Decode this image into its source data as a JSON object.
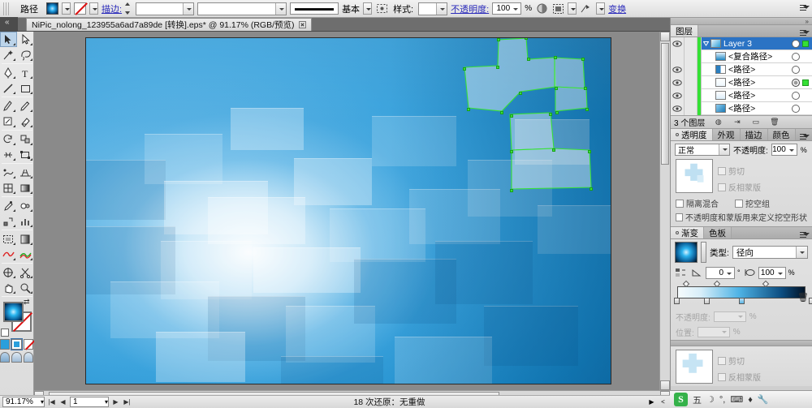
{
  "app": {
    "name": "Adobe Illustrator"
  },
  "control_bar": {
    "context_label": "路径",
    "fill_label": "fill-swatch",
    "stroke_label": "stroke-swatch",
    "stroke_text": "描边:",
    "stroke_weight": "",
    "stroke_profile": "",
    "brush_name": "基本",
    "style_text": "样式:",
    "style_value": "",
    "opacity_text": "不透明度:",
    "opacity_value": "100",
    "percent": "%",
    "transform_link": "变换",
    "icons": [
      "fill-swatch-icon",
      "stroke-swatch-icon",
      "stroke-weight-stepper",
      "brush-definition-icon",
      "graphic-style-icon",
      "opacity-icon",
      "align-icon",
      "transform-icon",
      "panel-menu-icon"
    ]
  },
  "tab_bar": {
    "document_title": "NiPic_nolong_123955a6ad7a89de [转换].eps* @ 91.17% (RGB/预览)",
    "close_icon": "close-icon"
  },
  "tools": {
    "rows": [
      [
        {
          "n": "selection-tool",
          "g": "arrow-solid",
          "sel": true
        },
        {
          "n": "direct-selection-tool",
          "g": "arrow-hollow",
          "sel": false
        }
      ],
      [
        {
          "n": "magic-wand-tool",
          "g": "wand",
          "sel": false
        },
        {
          "n": "lasso-tool",
          "g": "lasso",
          "sel": false
        }
      ],
      [
        {
          "n": "pen-tool",
          "g": "pen",
          "sel": false
        },
        {
          "n": "type-tool",
          "g": "type",
          "sel": false
        }
      ],
      [
        {
          "n": "line-segment-tool",
          "g": "line",
          "sel": false
        },
        {
          "n": "rectangle-tool",
          "g": "rect",
          "sel": false
        }
      ],
      [
        {
          "n": "paintbrush-tool",
          "g": "brush",
          "sel": false
        },
        {
          "n": "pencil-tool",
          "g": "pencil",
          "sel": false
        }
      ],
      [
        {
          "n": "blob-brush-tool",
          "g": "blob",
          "sel": false
        },
        {
          "n": "eraser-tool",
          "g": "eraser",
          "sel": false
        }
      ],
      [
        {
          "n": "rotate-tool",
          "g": "rotate",
          "sel": false
        },
        {
          "n": "scale-tool",
          "g": "scale",
          "sel": false
        }
      ],
      [
        {
          "n": "width-tool",
          "g": "width",
          "sel": false
        },
        {
          "n": "free-transform-tool",
          "g": "freetrans",
          "sel": false
        }
      ],
      [
        {
          "n": "shape-builder-tool",
          "g": "shapebuild",
          "sel": false
        },
        {
          "n": "perspective-grid-tool",
          "g": "persp",
          "sel": false
        }
      ],
      [
        {
          "n": "mesh-tool",
          "g": "mesh",
          "sel": false
        },
        {
          "n": "gradient-tool",
          "g": "gradient",
          "sel": false
        }
      ],
      [
        {
          "n": "eyedropper-tool",
          "g": "eyedrop",
          "sel": false
        },
        {
          "n": "blend-tool",
          "g": "blend",
          "sel": false
        }
      ],
      [
        {
          "n": "symbol-sprayer-tool",
          "g": "symbol",
          "sel": false
        },
        {
          "n": "column-graph-tool",
          "g": "graph",
          "sel": false
        }
      ],
      [
        {
          "n": "artboard-tool",
          "g": "artboard",
          "sel": false
        },
        {
          "n": "slice-tool",
          "g": "slice",
          "sel": false
        }
      ],
      [
        {
          "n": "warp-tool",
          "g": "warp",
          "sel": false
        },
        {
          "n": "curvature-tool",
          "g": "curve",
          "sel": false
        }
      ],
      [
        {
          "n": "symbol-shifter-tool",
          "g": "symshift",
          "sel": false
        },
        {
          "n": "scissors-tool",
          "g": "scissors",
          "sel": false
        }
      ],
      [
        {
          "n": "hand-tool",
          "g": "hand",
          "sel": false
        },
        {
          "n": "zoom-tool",
          "g": "zoom",
          "sel": false
        }
      ]
    ],
    "fill_stroke": {
      "fill_name": "fill-color-swatch",
      "stroke_name": "stroke-color-swatch",
      "swap_icon": "swap-fill-stroke-icon",
      "default_icon": "default-fill-stroke-icon"
    },
    "color_modes": [
      "color-mode-button",
      "gradient-mode-button",
      "none-mode-button"
    ],
    "screen_modes": [
      "normal-screen-mode",
      "full-screen-menu-mode",
      "full-screen-mode"
    ]
  },
  "canvas": {
    "artboard_name": "artboard",
    "selected_paths_note": "selected-path-outlines"
  },
  "status_bar": {
    "zoom_value": "91.17%",
    "page_value": "1",
    "undo_text": "18 次还原：无重做",
    "nav_first": "|◀",
    "nav_prev": "◀",
    "nav_next": "▶",
    "nav_last": "▶|",
    "menu_caret": "▶",
    "resize_caret": "<"
  },
  "panels": {
    "layers": {
      "tab_label": "图层",
      "menu_icon": "panel-menu-icon",
      "rows": [
        {
          "name": "Layer 3",
          "selected": true,
          "eye": true,
          "target_on": false,
          "has_sel_square": true,
          "thumb": "layer-thumb-blue",
          "indent": 0,
          "disclosure": true
        },
        {
          "name": "<复合路径>",
          "selected": false,
          "eye": false,
          "target_on": false,
          "has_sel_square": false,
          "thumb": "path-thumb-gradient",
          "indent": 1,
          "disclosure": false
        },
        {
          "name": "<路径>",
          "selected": false,
          "eye": true,
          "target_on": false,
          "has_sel_square": false,
          "thumb": "path-thumb-half",
          "indent": 1,
          "disclosure": false
        },
        {
          "name": "<路径>",
          "selected": false,
          "eye": true,
          "target_on": true,
          "has_sel_square": true,
          "thumb": "path-thumb-light",
          "indent": 1,
          "disclosure": false
        },
        {
          "name": "<路径>",
          "selected": false,
          "eye": true,
          "target_on": false,
          "has_sel_square": false,
          "thumb": "path-thumb-light2",
          "indent": 1,
          "disclosure": false
        },
        {
          "name": "<路径>",
          "selected": false,
          "eye": true,
          "target_on": false,
          "has_sel_square": false,
          "thumb": "path-thumb-blue2",
          "indent": 1,
          "disclosure": false
        }
      ],
      "footer_count": "3 个图层",
      "footer_icons": [
        "make-clipping-mask-icon",
        "create-new-sublayer-icon",
        "create-new-layer-icon",
        "delete-layer-icon"
      ]
    },
    "transparency": {
      "tabs": [
        {
          "label": "透明度",
          "active": true
        },
        {
          "label": "外观",
          "active": false
        },
        {
          "label": "描边",
          "active": false
        },
        {
          "label": "颜色",
          "active": false
        }
      ],
      "blend_mode": "正常",
      "opacity_label": "不透明度:",
      "opacity_value": "100",
      "percent": "%",
      "thumb_name": "transparency-thumbnail",
      "clip_label": "剪切",
      "invert_mask_label": "反相蒙版",
      "isolate_label": "隔离混合",
      "knockout_label": "挖空组",
      "opacity_mask_label": "不透明度和蒙版用来定义挖空形状",
      "menu_icon": "panel-menu-icon"
    },
    "gradient": {
      "tabs": [
        {
          "label": "渐变",
          "active": true
        },
        {
          "label": "色板",
          "active": false
        }
      ],
      "type_label": "类型:",
      "type_value": "径向",
      "angle_value": "0",
      "angle_unit": "°",
      "aspect_value": "100",
      "aspect_unit": "%",
      "reverse_icon": "reverse-gradient-icon",
      "angle_icon": "angle-icon",
      "aspect_icon": "aspect-ratio-icon",
      "delete_stop_icon": "delete-stop-icon",
      "opacity_label": "不透明度:",
      "location_label": "位置:",
      "stops": [
        {
          "position": 0,
          "color": "#f7fcfe"
        },
        {
          "position": 22,
          "color": "#cfe9f6"
        },
        {
          "position": 48,
          "color": "#39a8e0"
        },
        {
          "position": 100,
          "color": "#02101f"
        }
      ],
      "midpoints": [
        7,
        30,
        66
      ],
      "menu_icon": "panel-menu-icon"
    },
    "transparency_bottom": {
      "thumb_name": "transparency-thumbnail-2",
      "clip_label": "剪切",
      "invert_mask_label": "反相蒙版",
      "footer_icons": [
        "make-opacity-mask-icon",
        "release-opacity-mask-icon"
      ]
    }
  },
  "ime_bar": {
    "logo": "S",
    "items": [
      "五",
      "☽",
      "°,",
      "⌨",
      "♦",
      "🔧"
    ],
    "icon_names": [
      "sogou-logo-icon",
      "input-mode-icon",
      "moon-icon",
      "punctuation-icon",
      "keyboard-icon",
      "toolbox-icon",
      "settings-icon"
    ]
  },
  "colors": {
    "accent_blue": "#1e8ec8",
    "selection_green": "#35e035",
    "layer_selected": "#2b73c4",
    "link_blue": "#2b2bbb"
  }
}
